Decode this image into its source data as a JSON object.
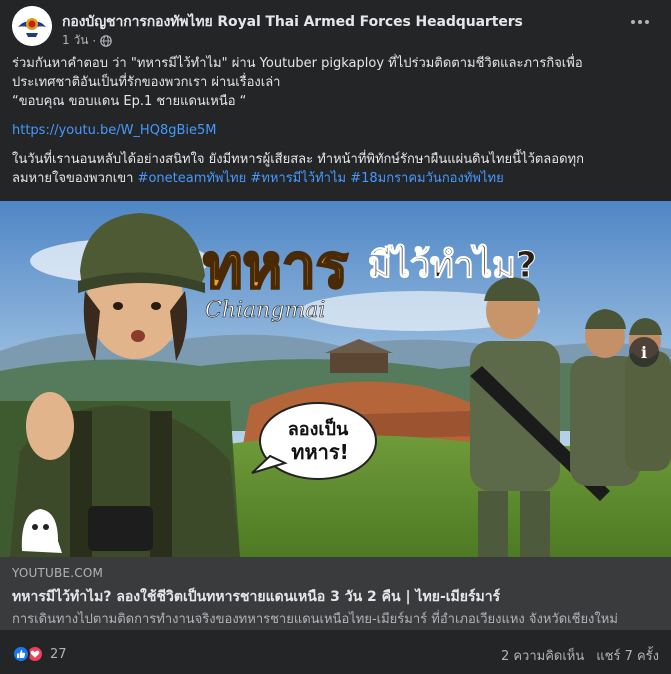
{
  "header": {
    "page_name": "กองบัญชาการกองทัพไทย Royal Thai Armed Forces Headquarters",
    "time": "1 วัน",
    "separator": "·",
    "privacy_icon": "globe-icon",
    "more_icon": "more-options-icon"
  },
  "post": {
    "line1": "ร่วมกันหาคำตอบ ว่า \"ทหารมีไว้ทำไม\" ผ่าน Youtuber pigkaploy ที่ไปร่วมติดตามชีวิตและภารกิจเพื่อ",
    "line2": "ประเทศชาติอันเป็นที่รักของพวกเรา ผ่านเรื่องเล่า",
    "line3": "“ขอบคุณ ขอบแดน Ep.1 ชายแดนเหนือ “",
    "link": "https://youtu.be/W_HQ8gBie5M",
    "para2_line1": "ในวันที่เรานอนหลับได้อย่างสนิทใจ ยังมีทหารผู้เสียสละ ทำหน้าที่พิทักษ์รักษาผืนแผ่นดินไทยนี้ไว้ตลอดทุก",
    "para2_line2": "ลมหายใจของพวกเขา",
    "hashtags": [
      "#oneteamทัพไทย",
      "#ทหารมีไว้ทำไม",
      "#18มกราคมวันกองทัพไทย"
    ]
  },
  "thumbnail": {
    "title_big": "ทหาร",
    "title_small": "มีไว้ทำไม?",
    "location": "Chiangmai",
    "bubble": [
      "ลองเป็น",
      "ทหาร!"
    ],
    "info_label": "i"
  },
  "preview": {
    "domain": "YOUTUBE.COM",
    "title": "ทหารมีไว้ทำไม? ลองใช้ชีวิตเป็นทหารชายแดนเหนือ 3 วัน 2 คืน | ไทย-เมียร์มาร์",
    "description": "การเดินทางไปตามติดการทำงานจริงของทหารชายแดนเหนือไทย-เมียร์มาร์ ที่อำเภอเวียงแหง จังหวัดเชียงใหม่"
  },
  "footer": {
    "reaction_count": "27",
    "comments": "2 ความคิดเห็น",
    "shares": "แชร์ 7 ครั้ง"
  },
  "colors": {
    "background": "#242526",
    "link": "#4599ff",
    "preview_bg": "#3a3b3c",
    "like": "#1877f2",
    "love": "#f33e58",
    "title_orange": "#f0a020"
  }
}
